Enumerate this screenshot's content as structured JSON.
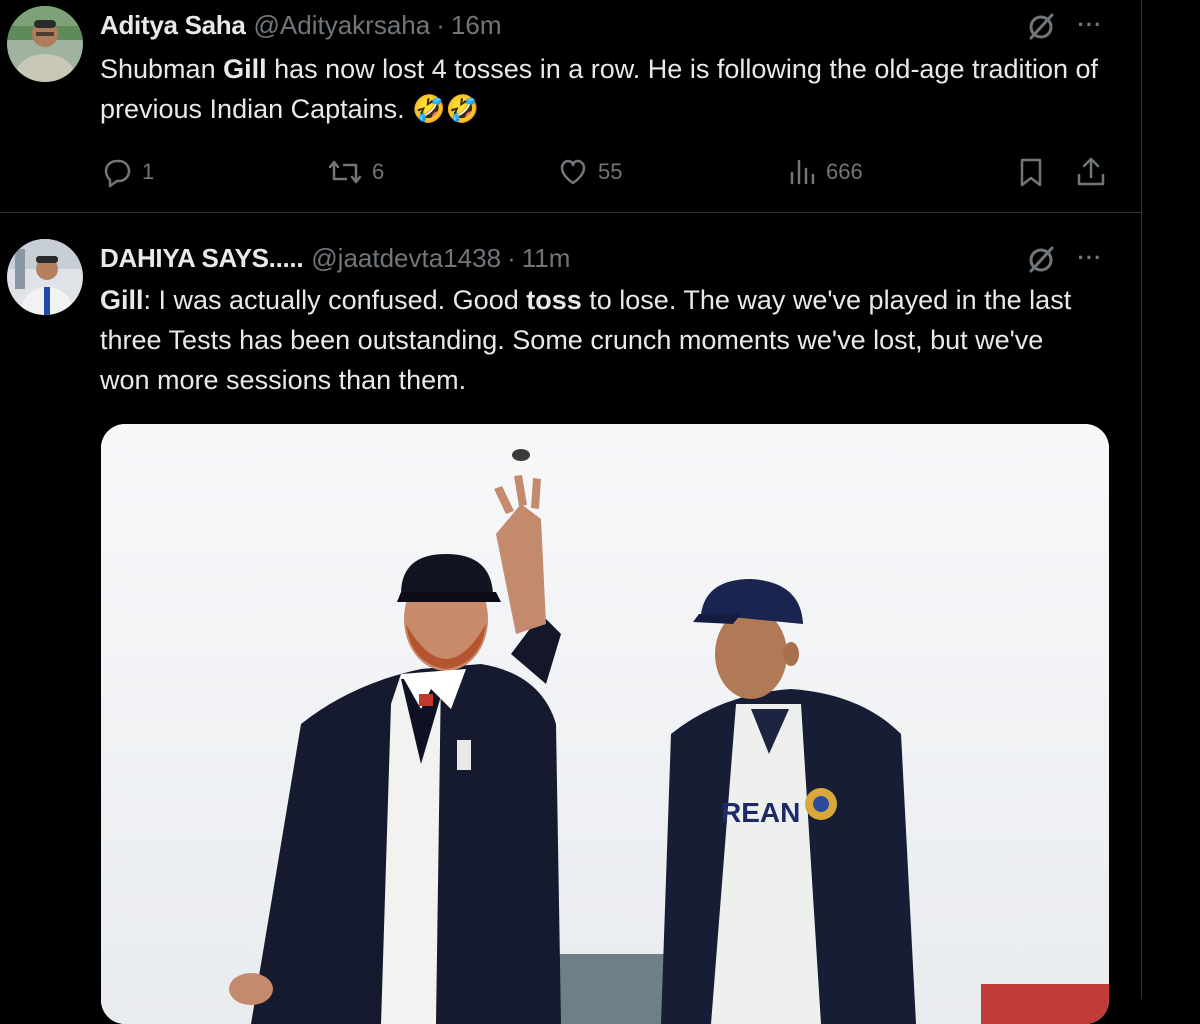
{
  "tweets": [
    {
      "author_name": "Aditya Saha",
      "handle": "@Adityakrsaha",
      "separator": "·",
      "time": "16m",
      "text_parts": [
        "Shubman ",
        "Gill",
        " has now lost 4 tosses in a row. He is following the old-age tradition of previous Indian Captains. ",
        "🤣🤣"
      ],
      "stats": {
        "replies": "1",
        "reposts": "6",
        "likes": "55",
        "views": "666"
      },
      "more_label": "···"
    },
    {
      "author_name": "DAHIYA SAYS.....",
      "handle": "@jaatdevta1438",
      "separator": "·",
      "time": "11m",
      "text_parts": [
        "Gill",
        ": I was actually confused. Good ",
        "toss",
        " to lose. The way we've played in the last three Tests has been outstanding. Some crunch moments we've lost, but we've won more sessions than them."
      ],
      "more_label": "···",
      "media": {
        "description_icon": "photo",
        "shirt_text": "REAN"
      }
    }
  ],
  "icons": {
    "reply": "reply-icon",
    "repost": "repost-icon",
    "like": "heart-icon",
    "views": "views-icon",
    "bookmark": "bookmark-icon",
    "share": "share-icon",
    "grok": "grok-icon",
    "more": "more-icon"
  },
  "colors": {
    "background": "#000000",
    "text_primary": "#e7e9ea",
    "text_secondary": "#71767b",
    "border": "#2f3336"
  }
}
